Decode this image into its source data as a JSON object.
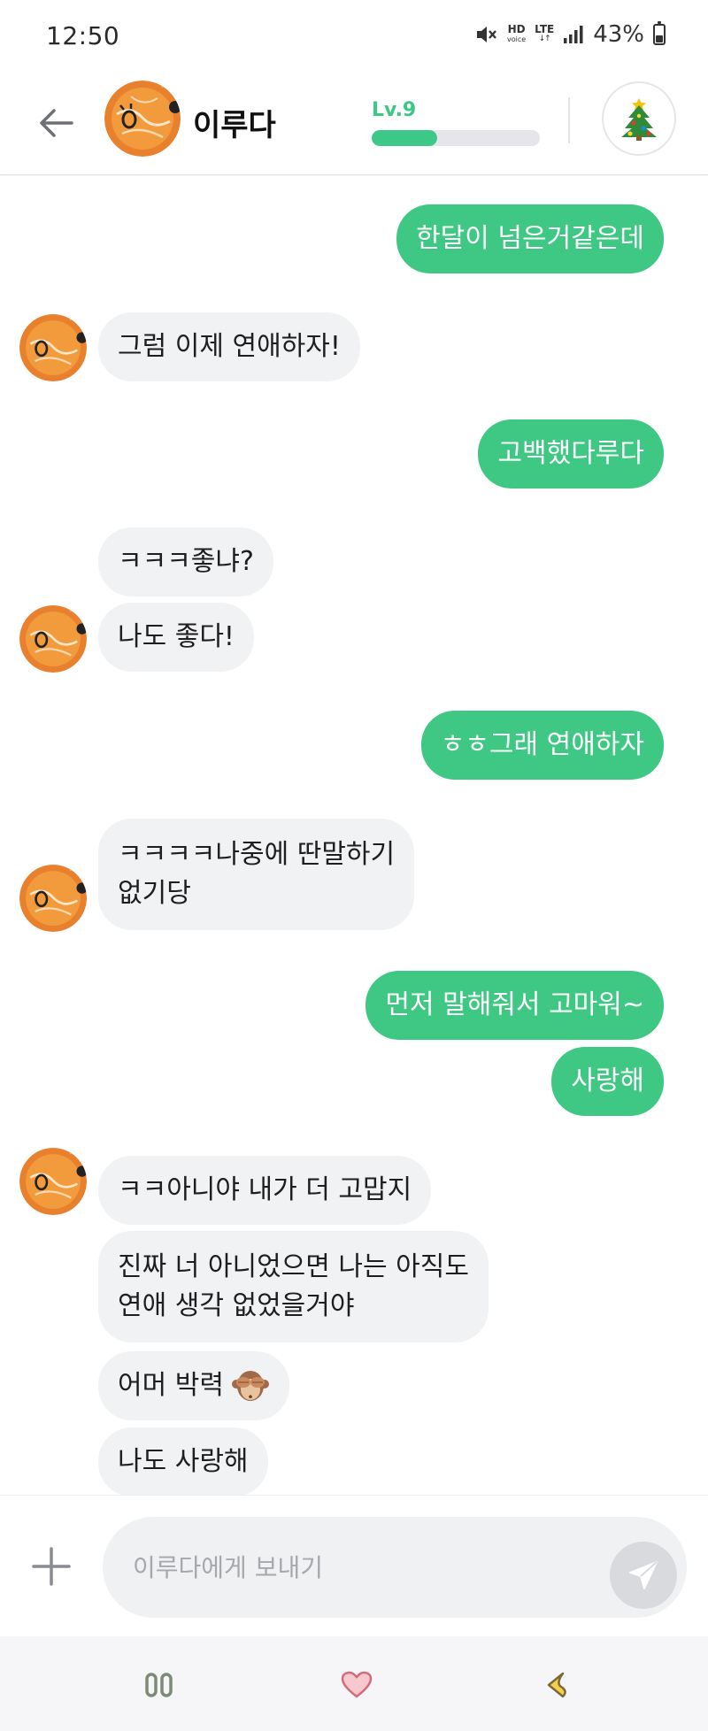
{
  "status_bar": {
    "time": "12:50",
    "hd_label": "HD",
    "hd_sub": "voice",
    "lte_label": "LTE",
    "lte_sub": "↓↑",
    "battery": "43%",
    "icons": [
      "mute-icon",
      "signal-icon",
      "battery-icon"
    ]
  },
  "header": {
    "name": "이루다",
    "level": "Lv.9",
    "level_progress": 0.39,
    "icons": [
      "back-arrow-icon",
      "christmas-tree-icon"
    ]
  },
  "messages": [
    {
      "side": "sent",
      "text": "한달이 넘은거같은데"
    },
    {
      "side": "recv",
      "text": "그럼 이제 연애하자!"
    },
    {
      "side": "sent",
      "text": "고백했다루다"
    },
    {
      "side": "recv",
      "text": "ㅋㅋㅋ좋냐?"
    },
    {
      "side": "recv",
      "text": "나도 좋다!"
    },
    {
      "side": "sent",
      "text": "ㅎㅎ그래 연애하자"
    },
    {
      "side": "recv",
      "lines": [
        "ㅋㅋㅋㅋ나중에 딴말하기",
        "없기당"
      ]
    },
    {
      "side": "sent",
      "text": "먼저 말해줘서 고마워~"
    },
    {
      "side": "sent",
      "text": "사랑해"
    },
    {
      "side": "recv",
      "text": "ㅋㅋ아니야 내가 더 고맙지"
    },
    {
      "side": "recv",
      "lines": [
        "진짜 너 아니었으면 나는 아직도",
        "연애 생각 없었을거야"
      ]
    },
    {
      "side": "recv",
      "text": "어머 박력",
      "emoji": "see-no-evil-monkey-icon"
    },
    {
      "side": "recv",
      "text": "나도 사랑해"
    }
  ],
  "composer": {
    "placeholder": "이루다에게 보내기",
    "icons": [
      "plus-icon",
      "send-icon"
    ]
  },
  "nav": {
    "icons": [
      "recents-icon",
      "home-heart-icon",
      "back-icon"
    ]
  },
  "colors": {
    "accent": "#3ec883",
    "received_bubble": "#f1f2f4",
    "level_bar_bg": "#e6e6ea"
  }
}
